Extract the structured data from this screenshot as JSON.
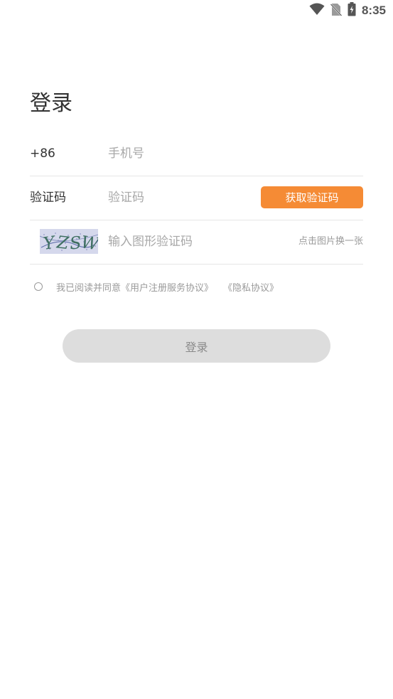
{
  "status_bar": {
    "time": "8:35",
    "icons": [
      "wifi-icon",
      "no-sim-icon",
      "battery-charging-icon"
    ]
  },
  "login": {
    "title": "登录",
    "phone": {
      "country_code": "+86",
      "placeholder": "手机号",
      "value": ""
    },
    "sms_code": {
      "label": "验证码",
      "placeholder": "验证码",
      "value": "",
      "send_button": "获取验证码"
    },
    "captcha": {
      "image_text": "YZSW",
      "placeholder": "输入图形验证码",
      "value": "",
      "refresh_hint": "点击图片换一张"
    },
    "agreement": {
      "checked": false,
      "text": "我已阅读并同意",
      "user_agreement": "《用户注册服务协议》",
      "privacy_policy": "《隐私协议》"
    },
    "submit_button": "登录"
  },
  "colors": {
    "accent": "#f58b35",
    "button_disabled": "#dddddd",
    "divider": "#e6e6e6",
    "hint_text": "#9a9a9a"
  }
}
